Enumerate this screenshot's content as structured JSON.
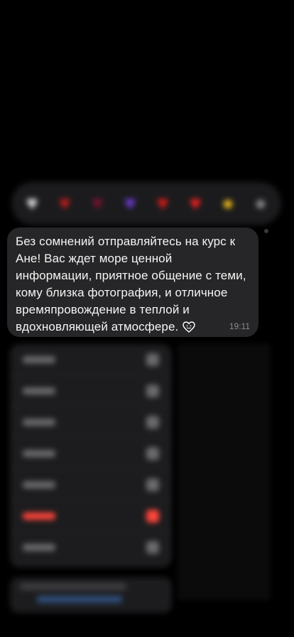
{
  "reactions": [
    {
      "icon": "white-heart-icon",
      "glyph": "♥",
      "color": "#e8e8e8"
    },
    {
      "icon": "red-heart-icon",
      "glyph": "♥",
      "color": "#c81e1e"
    },
    {
      "icon": "heart-figure-icon",
      "glyph": "♥",
      "color": "#7a1230"
    },
    {
      "icon": "purple-heart-icon",
      "glyph": "♥",
      "color": "#6f3bd6"
    },
    {
      "icon": "red-heart-icon",
      "glyph": "♥",
      "color": "#e31b1b"
    },
    {
      "icon": "red-heart-icon",
      "glyph": "♥",
      "color": "#ff2020"
    },
    {
      "icon": "yellow-emoji-icon",
      "glyph": "●",
      "color": "#f4c21b"
    },
    {
      "icon": "add-reaction-icon",
      "glyph": "●",
      "color": "#8e8e93"
    }
  ],
  "message": {
    "text": "Без сомнений отправляйтесь на курс к Ане! Вас ждет море ценной информации, приятное общение с теми, кому близка фотография, и отличное времяпровождение в теплой и вдохновляющей атмосфере.",
    "time": "19:11",
    "bubble_color": "#262628"
  },
  "menu": {
    "items": [
      {
        "name": "menu-item-reply",
        "danger": false
      },
      {
        "name": "menu-item-copy",
        "danger": false
      },
      {
        "name": "menu-item-forward",
        "danger": false
      },
      {
        "name": "menu-item-pin",
        "danger": false
      },
      {
        "name": "menu-item-report",
        "danger": false
      },
      {
        "name": "menu-item-delete",
        "danger": true
      },
      {
        "name": "menu-item-select",
        "danger": false
      }
    ]
  }
}
